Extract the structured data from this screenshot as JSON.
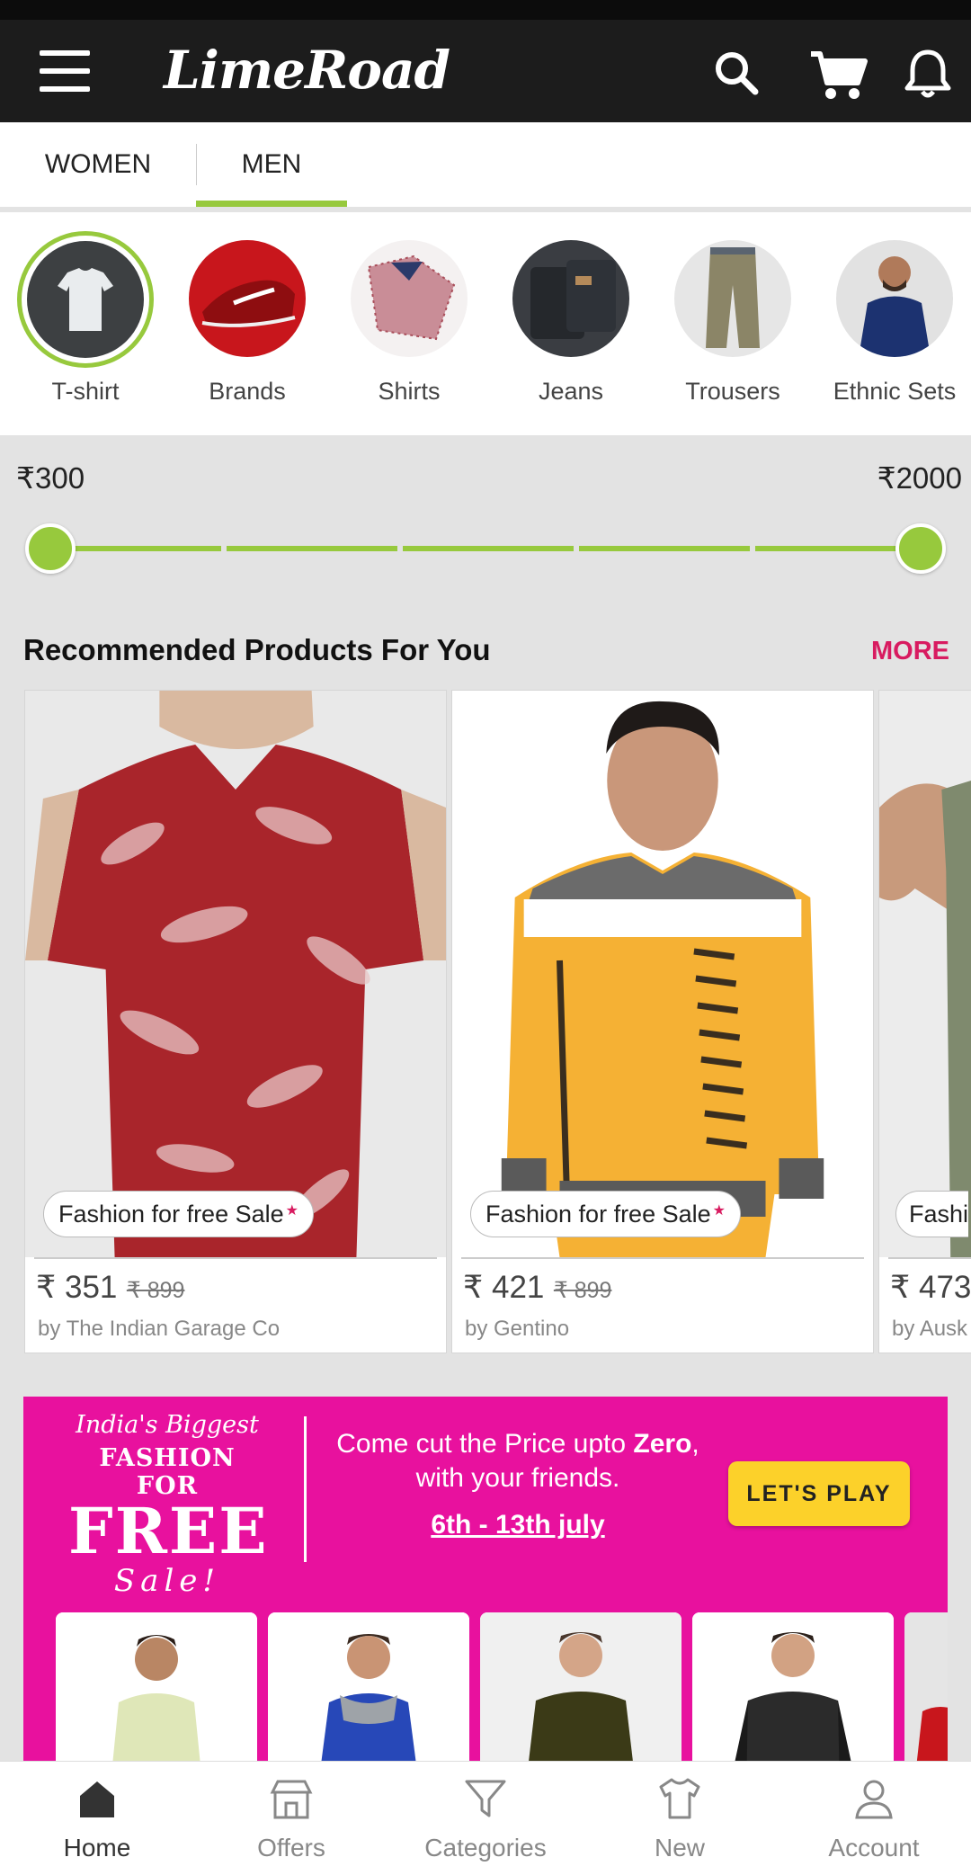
{
  "app": {
    "logo_text": "LimeRoad"
  },
  "header": {
    "icons": [
      "menu-icon",
      "search-icon",
      "cart-icon",
      "bell-icon"
    ]
  },
  "gender_tabs": [
    {
      "label": "WOMEN",
      "active": false
    },
    {
      "label": "MEN",
      "active": true
    }
  ],
  "categories": [
    {
      "label": "T-shirt",
      "active": true
    },
    {
      "label": "Brands",
      "active": false
    },
    {
      "label": "Shirts",
      "active": false
    },
    {
      "label": "Jeans",
      "active": false
    },
    {
      "label": "Trousers",
      "active": false
    },
    {
      "label": "Ethnic Sets",
      "active": false
    }
  ],
  "price_filter": {
    "min_label": "₹300",
    "max_label": "₹2000"
  },
  "recommended": {
    "title": "Recommended Products For You",
    "more_label": "MORE",
    "products": [
      {
        "tag": "Fashion for free Sale",
        "price": "₹ 351",
        "mrp": "₹ 899",
        "brand": "by The Indian Garage Co"
      },
      {
        "tag": "Fashion for free Sale",
        "price": "₹ 421",
        "mrp": "₹ 899",
        "brand": "by Gentino"
      },
      {
        "tag": "Fashi",
        "price": "₹ 473",
        "mrp": "",
        "brand": "by Ausk"
      }
    ]
  },
  "banner": {
    "line1": "India's Biggest",
    "line2": "FASHION FOR",
    "line3": "FREE",
    "line4": "Sale!",
    "text_part1": "Come cut the Price upto ",
    "text_bold": "Zero",
    "text_part2": ", with your friends.",
    "dates": "6th - 13th july",
    "cta_label": "LET'S PLAY"
  },
  "bottom_nav": [
    {
      "label": "Home",
      "icon": "home-icon",
      "active": true
    },
    {
      "label": "Offers",
      "icon": "offers-icon",
      "active": false
    },
    {
      "label": "Categories",
      "icon": "filter-icon",
      "active": false
    },
    {
      "label": "New",
      "icon": "tshirt-icon",
      "active": false
    },
    {
      "label": "Account",
      "icon": "user-icon",
      "active": false
    }
  ],
  "colors": {
    "accent_green": "#97c93d",
    "brand_pink": "#e8119e",
    "more_pink": "#d81b60",
    "cta_yellow": "#fcd12a",
    "header_dark": "#1c1c1c"
  }
}
